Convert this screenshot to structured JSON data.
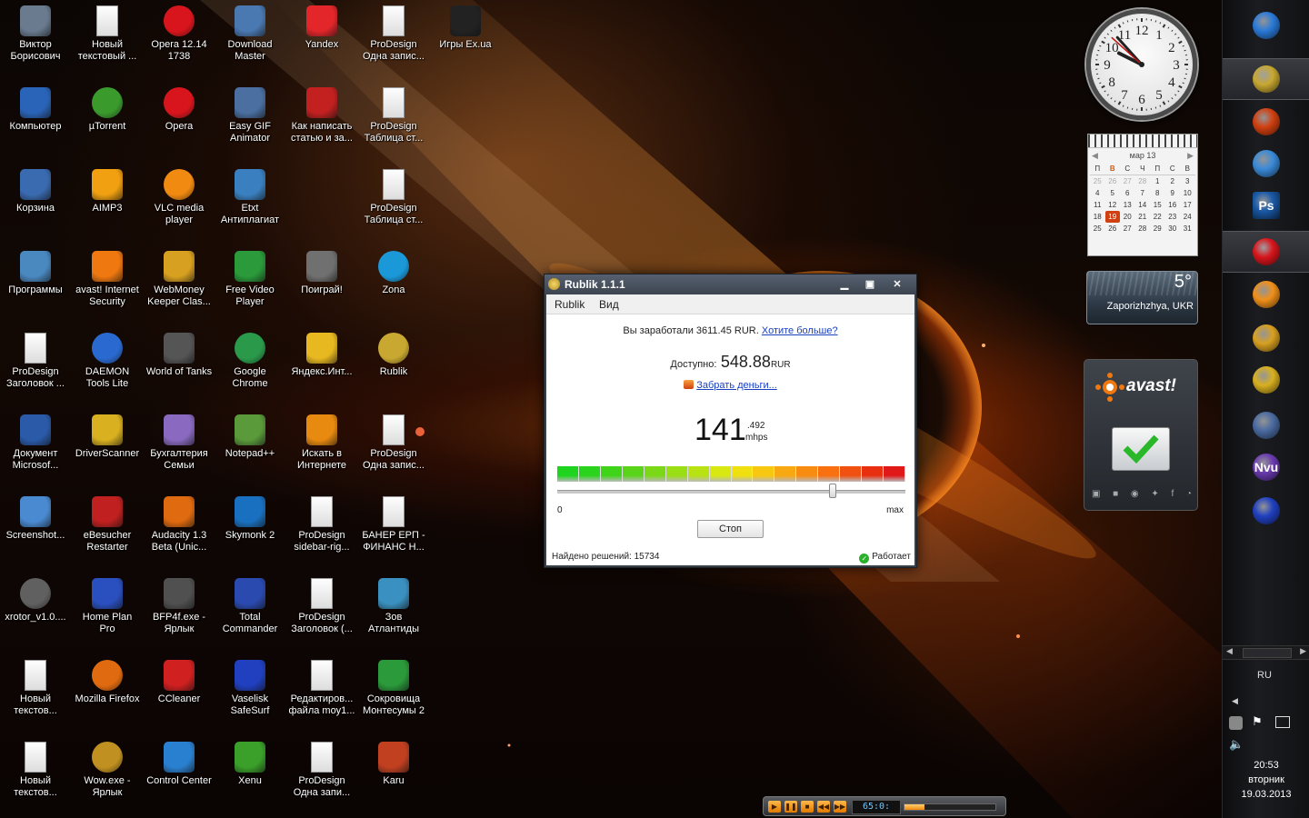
{
  "desktop_icons": [
    {
      "label": "Виктор Борисович",
      "icon": "user-folder-icon",
      "color": "#6a7b90"
    },
    {
      "label": "Новый текстовый ...",
      "icon": "text-document-icon",
      "color": "#f2f2f2"
    },
    {
      "label": "Opera 12.14 1738",
      "icon": "opera-icon",
      "color": "#d8151c"
    },
    {
      "label": "Download Master",
      "icon": "download-master-icon",
      "color": "#4a78b0"
    },
    {
      "label": "Yandex",
      "icon": "yandex-browser-icon",
      "color": "#e3262a"
    },
    {
      "label": "ProDesign Одна запис...",
      "icon": "text-document-icon",
      "color": "#f2f2f2"
    },
    {
      "label": "Игры Ex.ua",
      "icon": "exua-icon",
      "color": "#222222"
    },
    {
      "label": "Компьютер",
      "icon": "computer-icon",
      "color": "#2a64b8"
    },
    {
      "label": "µTorrent",
      "icon": "utorrent-icon",
      "color": "#3a9a2c"
    },
    {
      "label": "Opera",
      "icon": "opera-icon",
      "color": "#d8151c"
    },
    {
      "label": "Easy GIF Animator",
      "icon": "gif-animator-icon",
      "color": "#4a6fa0"
    },
    {
      "label": "Как написать статью и за...",
      "icon": "book-icon",
      "color": "#c32020"
    },
    {
      "label": "ProDesign Таблица ст...",
      "icon": "text-document-icon",
      "color": "#f2f2f2"
    },
    {
      "label": "Корзина",
      "icon": "recycle-bin-icon",
      "color": "#3a6ab0"
    },
    {
      "label": "AIMP3",
      "icon": "aimp-icon",
      "color": "#f0a010"
    },
    {
      "label": "VLC media player",
      "icon": "vlc-icon",
      "color": "#f08a10"
    },
    {
      "label": "Etxt Антиплагиат",
      "icon": "etxt-icon",
      "color": "#3a80c0"
    },
    {
      "label": "ProDesign Таблица ст...",
      "icon": "text-document-icon",
      "color": "#f2f2f2"
    },
    {
      "label": "Программы",
      "icon": "programs-folder-icon",
      "color": "#4a88c0"
    },
    {
      "label": "avast! Internet Security",
      "icon": "avast-icon",
      "color": "#f07810"
    },
    {
      "label": "WebMoney Keeper Clas...",
      "icon": "webmoney-icon",
      "color": "#d8a020"
    },
    {
      "label": "Free Video Player",
      "icon": "video-player-icon",
      "color": "#2a9a3a"
    },
    {
      "label": "Поиграй!",
      "icon": "gamepad-icon",
      "color": "#707070"
    },
    {
      "label": "Zona",
      "icon": "zona-icon",
      "color": "#1a98d8"
    },
    {
      "label": "ProDesign Заголовок ...",
      "icon": "text-document-icon",
      "color": "#f2f2f2"
    },
    {
      "label": "DAEMON Tools Lite",
      "icon": "daemon-tools-icon",
      "color": "#2a6ad0"
    },
    {
      "label": "World of Tanks",
      "icon": "world-of-tanks-icon",
      "color": "#555555"
    },
    {
      "label": "Google Chrome",
      "icon": "chrome-icon",
      "color": "#2a9a4a"
    },
    {
      "label": "Яндекс.Инт...",
      "icon": "yandex-disk-icon",
      "color": "#e8b820"
    },
    {
      "label": "Rublik",
      "icon": "rublik-coin-icon",
      "color": "#c8a830"
    },
    {
      "label": "Документ Microsof...",
      "icon": "word-document-icon",
      "color": "#2a5aa8"
    },
    {
      "label": "DriverScanner",
      "icon": "driver-scanner-icon",
      "color": "#d8b020"
    },
    {
      "label": "Бухгалтерия Семьи",
      "icon": "accounting-icon",
      "color": "#8a6ac0"
    },
    {
      "label": "Notepad++",
      "icon": "notepadpp-icon",
      "color": "#5a9a3a"
    },
    {
      "label": "Искать в Интернете",
      "icon": "search-web-icon",
      "color": "#e88a10"
    },
    {
      "label": "ProDesign Одна запис...",
      "icon": "text-document-icon",
      "color": "#f2f2f2"
    },
    {
      "label": "Screenshot...",
      "icon": "screenshot-icon",
      "color": "#4a8ad0"
    },
    {
      "label": "eBesucher Restarter",
      "icon": "ebesucher-icon",
      "color": "#c02020"
    },
    {
      "label": "Audacity 1.3 Beta (Unic...",
      "icon": "audacity-icon",
      "color": "#e06a10"
    },
    {
      "label": "Skymonk 2",
      "icon": "skymonk-icon",
      "color": "#1a70c0"
    },
    {
      "label": "ProDesign sidebar-rig...",
      "icon": "text-document-icon",
      "color": "#f2f2f2"
    },
    {
      "label": "БАНЕР ЕРП - ФИНАНС Н...",
      "icon": "text-document-icon",
      "color": "#f2f2f2"
    },
    {
      "label": "xrotor_v1.0....",
      "icon": "xrotor-icon",
      "color": "#606060"
    },
    {
      "label": "Home Plan Pro",
      "icon": "home-plan-icon",
      "color": "#2a50c0"
    },
    {
      "label": "BFP4f.exe - Ярлык",
      "icon": "bfp4f-icon",
      "color": "#505050"
    },
    {
      "label": "Total Commander",
      "icon": "total-commander-icon",
      "color": "#2a4ab0"
    },
    {
      "label": "ProDesign Заголовок (...",
      "icon": "text-document-icon",
      "color": "#f2f2f2"
    },
    {
      "label": "Зов Атлантиды",
      "icon": "atlantis-game-icon",
      "color": "#3a90c0"
    },
    {
      "label": "Новый текстов...",
      "icon": "text-document-icon",
      "color": "#f2f2f2"
    },
    {
      "label": "Mozilla Firefox",
      "icon": "firefox-icon",
      "color": "#e06a10"
    },
    {
      "label": "CCleaner",
      "icon": "ccleaner-icon",
      "color": "#d02020"
    },
    {
      "label": "Vaselisk SafeSurf",
      "icon": "safesurf-icon",
      "color": "#2040c0"
    },
    {
      "label": "Редактиров... файла moy1...",
      "icon": "text-document-icon",
      "color": "#f2f2f2"
    },
    {
      "label": "Сокровища Монтесумы 2",
      "icon": "montezuma-game-icon",
      "color": "#2a9a3a"
    },
    {
      "label": "Новый текстов...",
      "icon": "text-document-icon",
      "color": "#f2f2f2"
    },
    {
      "label": "Wow.exe - Ярлык",
      "icon": "wow-icon",
      "color": "#c09020"
    },
    {
      "label": "Control Center",
      "icon": "control-center-icon",
      "color": "#2a80d0"
    },
    {
      "label": "Xenu",
      "icon": "xenu-icon",
      "color": "#3aa02a"
    },
    {
      "label": "ProDesign Одна запи...",
      "icon": "text-document-icon",
      "color": "#f2f2f2"
    },
    {
      "label": "Karu",
      "icon": "karu-icon",
      "color": "#c04020"
    }
  ],
  "gadgets": {
    "clock": {
      "hour": 9,
      "minute": 53,
      "second": 0,
      "numerals": [
        "12",
        "1",
        "2",
        "3",
        "4",
        "5",
        "6",
        "7",
        "8",
        "9",
        "10",
        "11"
      ]
    },
    "calendar": {
      "month_label": "мар 13",
      "weekdays": [
        "П",
        "В",
        "С",
        "Ч",
        "П",
        "С",
        "В"
      ],
      "today": "19",
      "rows": [
        [
          "25",
          "26",
          "27",
          "28",
          "1",
          "2",
          "3"
        ],
        [
          "4",
          "5",
          "6",
          "7",
          "8",
          "9",
          "10"
        ],
        [
          "11",
          "12",
          "13",
          "14",
          "15",
          "16",
          "17"
        ],
        [
          "18",
          "19",
          "20",
          "21",
          "22",
          "23",
          "24"
        ],
        [
          "25",
          "26",
          "27",
          "28",
          "29",
          "30",
          "31"
        ]
      ]
    },
    "weather": {
      "temperature": "5°",
      "location": "Zaporizhzhya, UKR"
    },
    "avast": {
      "brand": "avast!"
    }
  },
  "window": {
    "title": "Rublik 1.1.1",
    "menu": [
      "Rublik",
      "Вид"
    ],
    "earned_text": "Вы заработали 3611.45 RUR.",
    "more_link": "Хотите больше?",
    "available_label": "Доступно:",
    "available_value": "548.88",
    "available_currency": "RUR",
    "withdraw_link": "Забрать деньги...",
    "speed_value": "141",
    "speed_fraction": ".492",
    "speed_unit": "mhps",
    "slider_fraction": 0.79,
    "scale_min": "0",
    "scale_max": "max",
    "stop_button": "Стоп",
    "solutions_text": "Найдено решений: 15734",
    "status_text": "Работает",
    "bar_colors": [
      "#1ed41e",
      "#2ad41c",
      "#3fd41a",
      "#5ad418",
      "#7ad816",
      "#9ade14",
      "#b8e212",
      "#d8e810",
      "#f0e010",
      "#f8c810",
      "#f8a810",
      "#f88c10",
      "#f87010",
      "#f05010",
      "#e83010",
      "#e01818"
    ]
  },
  "sidebar": {
    "items": [
      {
        "icon": "windows-start-icon",
        "color": "#2a7ad8"
      },
      {
        "icon": "rublik-coin-icon",
        "color": "#c8a830"
      },
      {
        "icon": "fire-ball-icon",
        "color": "#d04010"
      },
      {
        "icon": "disc-burner-icon",
        "color": "#3a8ad8"
      },
      {
        "icon": "photoshop-icon",
        "color": "#1a5aa8",
        "text": "Ps"
      },
      {
        "icon": "opera-icon",
        "color": "#d8151c"
      },
      {
        "icon": "bitcoin-icon",
        "color": "#f0901a"
      },
      {
        "icon": "bitcoin-gold-icon",
        "color": "#d8a020"
      },
      {
        "icon": "driver-scanner-icon",
        "color": "#d8b020"
      },
      {
        "icon": "xenu-tool-icon",
        "color": "#4a6aa0"
      },
      {
        "icon": "nvu-icon",
        "color": "#6a3ab0",
        "text": "Nvu"
      },
      {
        "icon": "safesurf-icon",
        "color": "#2040c0"
      }
    ],
    "language": "RU",
    "time": "20:53",
    "day": "вторник",
    "date": "19.03.2013"
  },
  "player": {
    "time": "65:0:"
  }
}
